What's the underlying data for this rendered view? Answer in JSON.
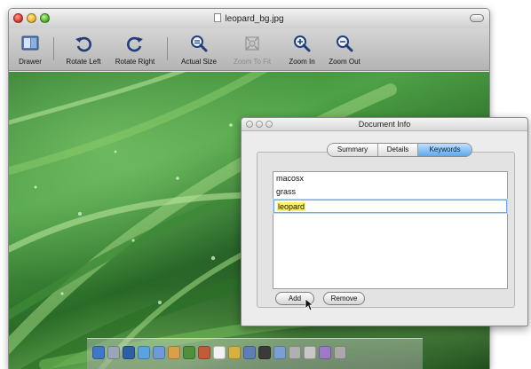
{
  "window": {
    "title": "leopard_bg.jpg",
    "title_icon": "document-icon",
    "traffic_lights": [
      "close",
      "minimize",
      "zoom"
    ]
  },
  "toolbar": {
    "items": [
      {
        "label": "Drawer",
        "icon": "drawer-icon",
        "enabled": true
      },
      {
        "label": "Rotate Left",
        "icon": "rotate-left-icon",
        "enabled": true
      },
      {
        "label": "Rotate Right",
        "icon": "rotate-right-icon",
        "enabled": true
      },
      {
        "label": "Actual Size",
        "icon": "actual-size-icon",
        "enabled": true
      },
      {
        "label": "Zoom To Fit",
        "icon": "zoom-to-fit-icon",
        "enabled": false
      },
      {
        "label": "Zoom In",
        "icon": "zoom-in-icon",
        "enabled": true
      },
      {
        "label": "Zoom Out",
        "icon": "zoom-out-icon",
        "enabled": true
      }
    ]
  },
  "panel": {
    "title": "Document Info",
    "tabs": [
      {
        "label": "Summary",
        "active": false
      },
      {
        "label": "Details",
        "active": false
      },
      {
        "label": "Keywords",
        "active": true
      }
    ],
    "keywords": [
      "macosx",
      "grass",
      "leopard"
    ],
    "editing_keyword_index": 2,
    "add_label": "Add",
    "remove_label": "Remove"
  },
  "colors": {
    "active_tab": "#5ea9ee",
    "edit_highlight": "#fff06a",
    "grass_green": "#4ea146"
  }
}
